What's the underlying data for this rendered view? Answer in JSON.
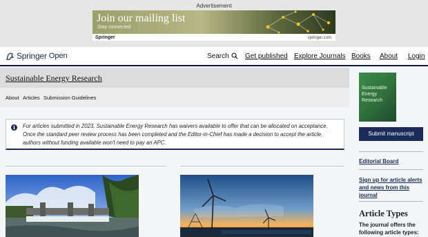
{
  "ad": {
    "label": "Advertisement",
    "title": "Join our mailing list",
    "subtitle": "Stay connected",
    "logo": "Springer",
    "url": "springer.com"
  },
  "header": {
    "brand_name": "Springer",
    "brand_suffix": "Open",
    "nav": {
      "search": "Search",
      "get_published": "Get published",
      "explore": "Explore Journals",
      "books": "Books",
      "about": "About",
      "login": "Login"
    }
  },
  "journal": {
    "title": "Sustainable Energy Research",
    "subnav": [
      "About",
      "Articles",
      "Submission Guidelines"
    ]
  },
  "notice": {
    "text": "For articles submitted in 2023, Sustainable Energy Research has waivers available to offer that can be allocated on acceptance. Once the standard peer review process has been completed and the Editor-in-Chief has made a decision to accept the article, authors without funding available won't need to pay an APC."
  },
  "sidebar": {
    "cover_title": "Sustainable Energy Research",
    "submit_label": "Submit manuscript",
    "editorial_board": "Editorial Board",
    "alerts_link": "Sign up for article alerts and news from this journal",
    "article_types_heading": "Article Types",
    "article_types_text": "The journal offers the following article types:"
  },
  "colors": {
    "navy": "#1b2c5a",
    "header_border": "#0c1a3a",
    "ad_green": "#9aa06a"
  }
}
